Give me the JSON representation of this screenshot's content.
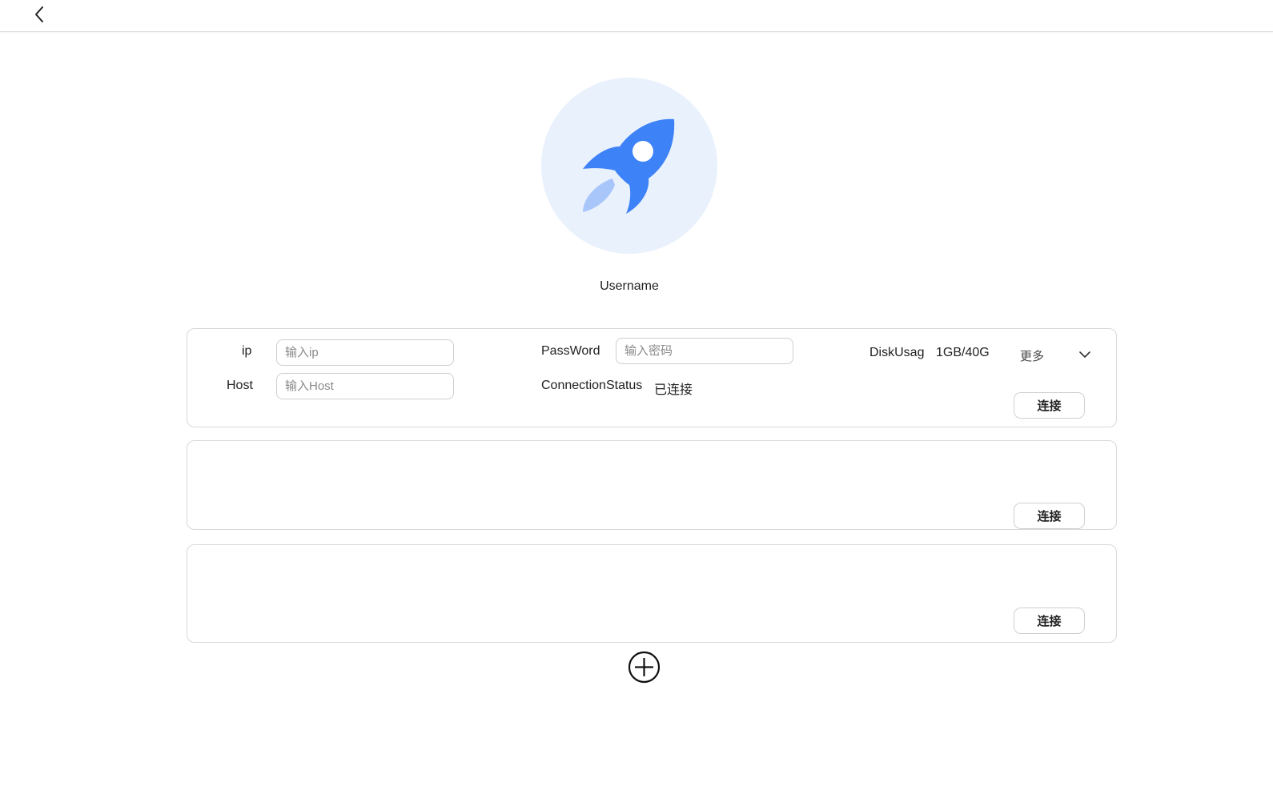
{
  "header": {
    "back_icon": "chevron-left-icon"
  },
  "profile": {
    "avatar_icon": "rocket-icon",
    "username": "Username",
    "colors": {
      "avatar_bg": "#e9f1fd",
      "rocket": "#3d82f7",
      "flame": "#a9c6fa"
    }
  },
  "connections": [
    {
      "ip_label": "ip",
      "ip_placeholder": "输入ip",
      "host_label": "Host",
      "host_placeholder": "输入Host",
      "password_label": "PassWord",
      "password_placeholder": "输入密码",
      "status_label": "ConnectionStatus",
      "status_value": "已连接",
      "disk_label": "DiskUsag",
      "disk_value": "1GB/40G",
      "more_label": "更多",
      "connect_label": "连接"
    },
    {
      "connect_label": "连接"
    },
    {
      "connect_label": "连接"
    }
  ],
  "footer": {
    "add_icon": "plus-circle-icon"
  }
}
